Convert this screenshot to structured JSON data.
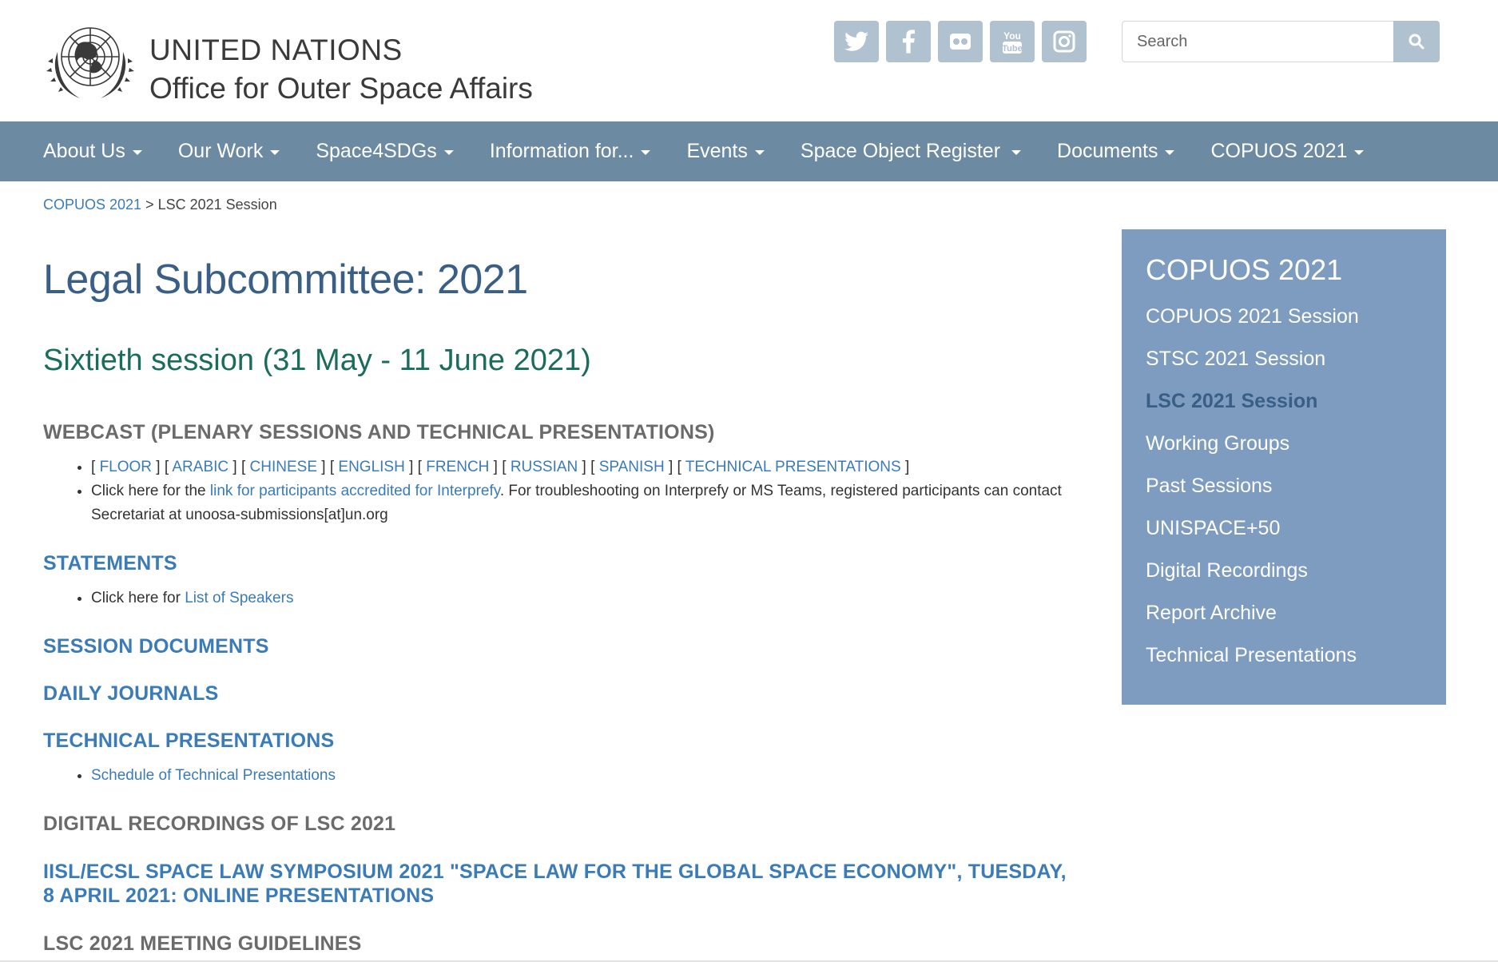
{
  "header": {
    "org_line1": "UNITED NATIONS",
    "org_line2": "Office for Outer Space Affairs",
    "social": [
      {
        "icon": "twitter-icon"
      },
      {
        "icon": "facebook-icon"
      },
      {
        "icon": "flickr-icon"
      },
      {
        "icon": "youtube-icon"
      },
      {
        "icon": "instagram-icon"
      }
    ],
    "search_placeholder": "Search",
    "search_value": ""
  },
  "nav": {
    "items": [
      {
        "label": "About Us"
      },
      {
        "label": "Our Work"
      },
      {
        "label": "Space4SDGs"
      },
      {
        "label": "Information for..."
      },
      {
        "label": "Events"
      },
      {
        "label": "Space Object Register"
      },
      {
        "label": "Documents"
      },
      {
        "label": "COPUOS 2021"
      }
    ]
  },
  "breadcrumb": {
    "parent": "COPUOS 2021",
    "separator": ">",
    "current": "LSC 2021 Session"
  },
  "main": {
    "title": "Legal Subcommittee: 2021",
    "subtitle": "Sixtieth session (31 May - 11 June 2021)",
    "webcast": {
      "heading": "WEBCAST (PLENARY SESSIONS AND TECHNICAL PRESENTATIONS)",
      "languages": [
        "FLOOR",
        "ARABIC",
        "CHINESE",
        "ENGLISH",
        "FRENCH",
        "RUSSIAN",
        "SPANISH",
        "TECHNICAL PRESENTATIONS"
      ],
      "interprefy_prefix": "Click here for the ",
      "interprefy_link": "link for participants accredited for Interprefy",
      "interprefy_suffix": ". For troubleshooting on Interprefy or MS Teams, registered participants can contact Secretariat at unoosa-submissions[at]un.org"
    },
    "statements": {
      "heading": "STATEMENTS",
      "prefix": "Click here for ",
      "link": "List of Speakers"
    },
    "session_documents": "SESSION DOCUMENTS",
    "daily_journals": "DAILY JOURNALS",
    "technical_presentations": {
      "heading": "TECHNICAL PRESENTATIONS",
      "link": "Schedule of Technical Presentations"
    },
    "digital_recordings": "DIGITAL RECORDINGS OF LSC 2021",
    "symposium": "IISL/ECSL SPACE LAW SYMPOSIUM 2021 \"SPACE LAW FOR THE GLOBAL SPACE ECONOMY\", TUESDAY, 8 APRIL 2021: ONLINE PRESENTATIONS",
    "guidelines": "LSC 2021 MEETING GUIDELINES"
  },
  "sidebar": {
    "title": "COPUOS 2021",
    "items": [
      {
        "label": "COPUOS 2021 Session",
        "active": false
      },
      {
        "label": "STSC 2021 Session",
        "active": false
      },
      {
        "label": "LSC 2021 Session",
        "active": true
      },
      {
        "label": "Working Groups",
        "active": false
      },
      {
        "label": "Past Sessions",
        "active": false
      },
      {
        "label": "UNISPACE+50",
        "active": false
      },
      {
        "label": "Digital Recordings",
        "active": false
      },
      {
        "label": "Report Archive",
        "active": false
      },
      {
        "label": "Technical Presentations",
        "active": false
      }
    ]
  },
  "colors": {
    "nav_bg": "#6d8aa3",
    "sidebar_bg": "#7d9cc0",
    "link": "#3a7bb8",
    "title": "#3a5f86",
    "session": "#1a6c5b",
    "social_bg": "#b0c1d0"
  }
}
